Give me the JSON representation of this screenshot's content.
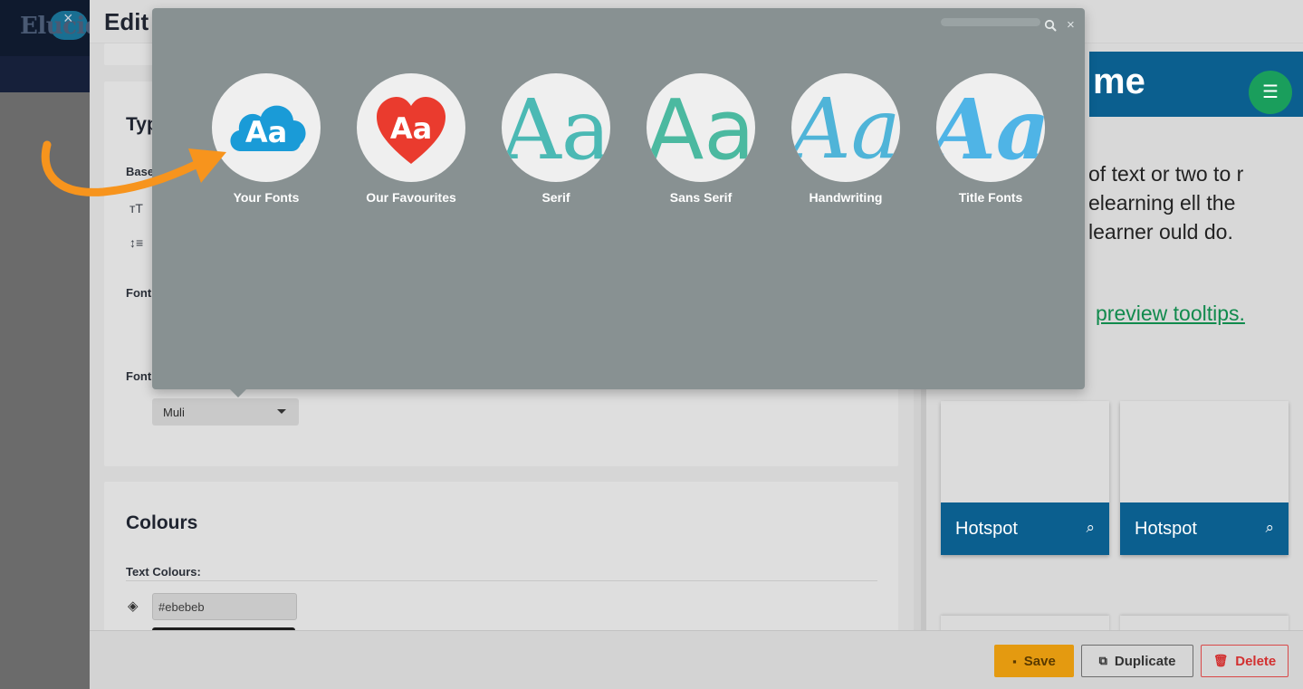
{
  "background_app": {
    "logo_text": "Elucid",
    "close_label": "×"
  },
  "editor": {
    "title": "Edit",
    "typography": {
      "heading": "Typ",
      "base_label": "Base",
      "font_label_1": "Font",
      "font_label_2": "Font",
      "font_select_value": "Muli"
    },
    "colours": {
      "heading": "Colours",
      "text_colours_label": "Text Colours:",
      "text_colour_value": "#ebebeb"
    }
  },
  "preview": {
    "title": "me",
    "body_text": "of text or two to r elearning ell the learner ould do.",
    "link_text": "preview tooltips.",
    "hotspots": [
      {
        "label": "Hotspot"
      },
      {
        "label": "Hotspot"
      }
    ],
    "colors": {
      "header": "#0b5f8f",
      "menu_button": "#1a9e5c",
      "link": "#118a4d"
    }
  },
  "font_picker": {
    "close_label": "×",
    "categories": [
      {
        "label": "Your Fonts",
        "icon": "cloud-aa-icon",
        "glyph": "Aa"
      },
      {
        "label": "Our Favourites",
        "icon": "heart-aa-icon",
        "glyph": "Aa"
      },
      {
        "label": "Serif",
        "icon": "serif-aa-icon",
        "glyph": "Aa"
      },
      {
        "label": "Sans Serif",
        "icon": "sans-serif-aa-icon",
        "glyph": "Aa"
      },
      {
        "label": "Handwriting",
        "icon": "handwriting-aa-icon",
        "glyph": "Aa"
      },
      {
        "label": "Title Fonts",
        "icon": "title-aa-icon",
        "glyph": "Aa"
      }
    ],
    "colors": {
      "background": "#889192",
      "cloud": "#1a9bd7",
      "heart": "#ea3b2e",
      "arrow": "#f7941d"
    }
  },
  "footer": {
    "save_label": "Save",
    "duplicate_label": "Duplicate",
    "delete_label": "Delete",
    "colors": {
      "save": "#e49a10",
      "delete": "#d23030"
    }
  }
}
